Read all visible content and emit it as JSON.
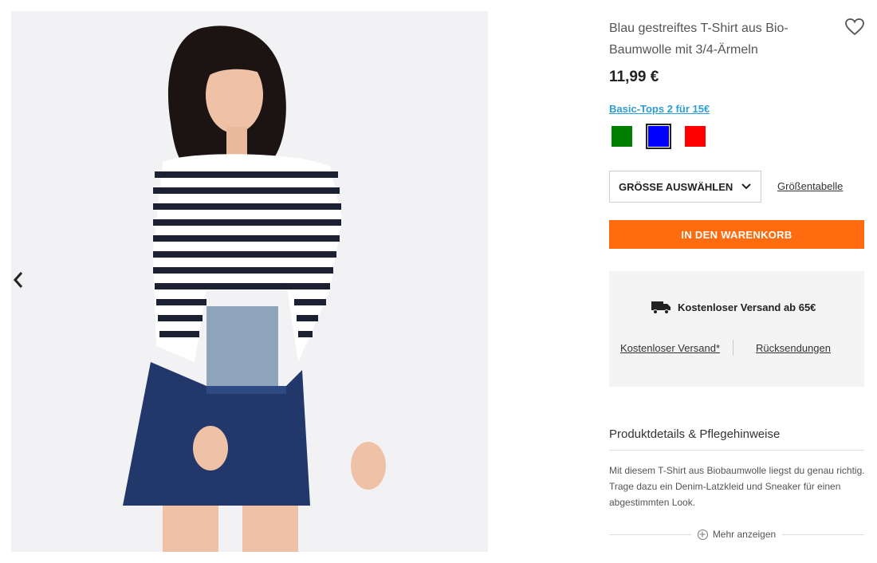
{
  "product": {
    "title": "Blau gestreiftes T-Shirt aus Bio-Baumwolle mit 3/4-Ärmeln",
    "price": "11,99 €",
    "promo_link": "Basic-Tops 2 für 15€",
    "favorite_icon": "heart-outline-icon"
  },
  "colors": [
    {
      "name": "green",
      "hex": "#008000",
      "selected": false
    },
    {
      "name": "blue",
      "hex": "#0000ff",
      "selected": true
    },
    {
      "name": "red",
      "hex": "#ff0000",
      "selected": false
    }
  ],
  "size": {
    "select_label": "GRÖSSE AUSWÄHLEN",
    "size_chart_link": "Größentabelle"
  },
  "cart": {
    "button_label": "IN DEN WARENKORB",
    "accent": "#ff6b0f"
  },
  "shipping": {
    "headline": "Kostenloser Versand ab 65€",
    "icon": "truck-icon",
    "link_free_shipping": "Kostenloser Versand*",
    "link_returns": "Rücksendungen"
  },
  "details": {
    "heading": "Produktdetails & Pflegehinweise",
    "text": "Mit diesem T-Shirt aus Biobaumwolle liegst du genau richtig. Trage dazu ein Denim-Latzkleid und Sneaker für einen abgestimmten Look.",
    "more_label": "Mehr anzeigen"
  },
  "gallery": {
    "prev_icon": "chevron-left-icon",
    "next_icon": "chevron-right-icon"
  }
}
